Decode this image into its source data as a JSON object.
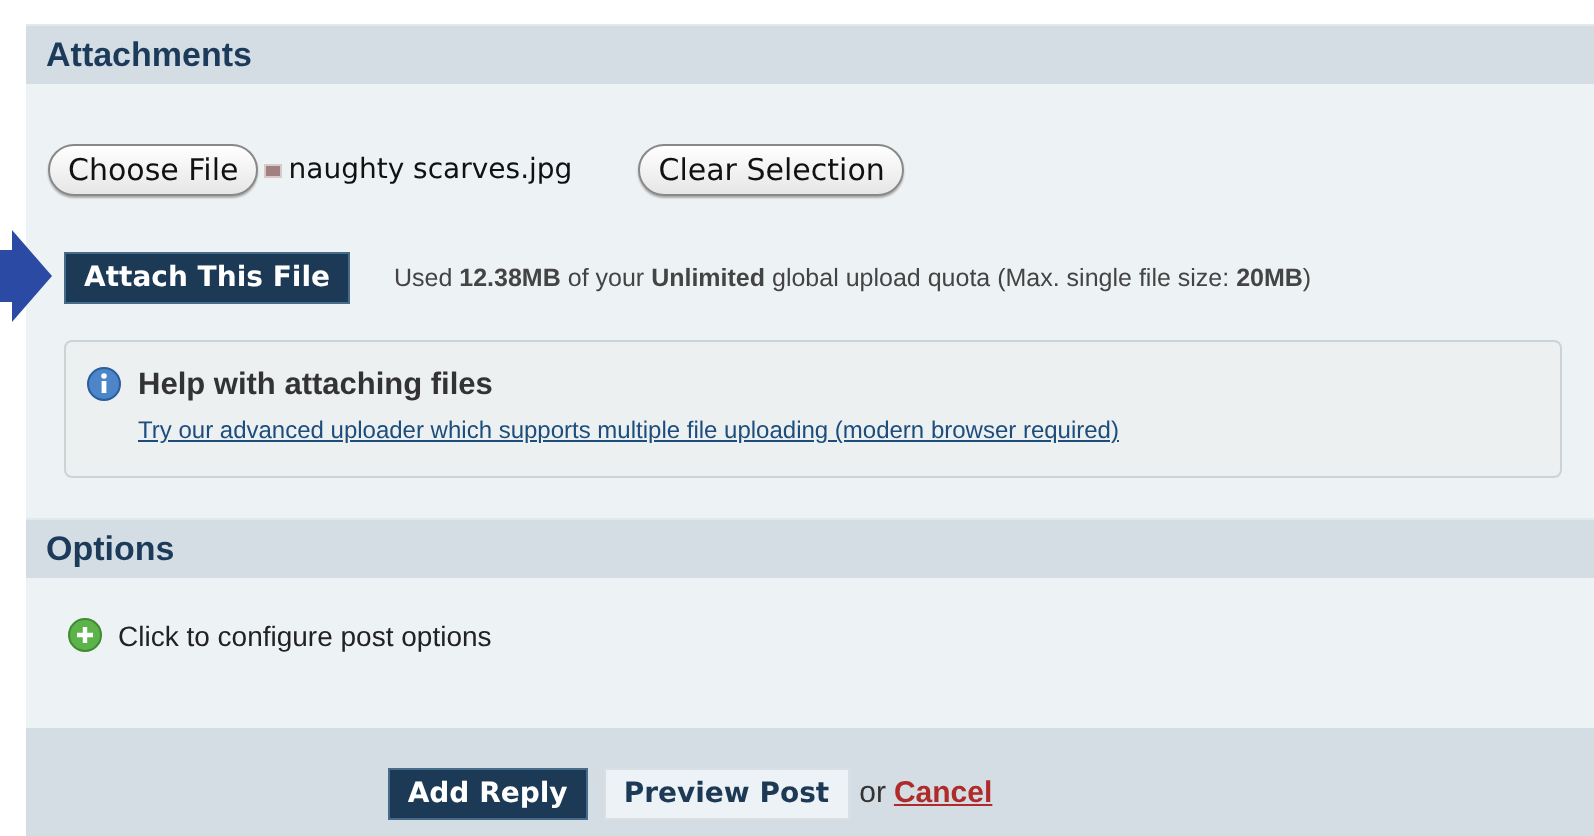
{
  "attachments": {
    "title": "Attachments",
    "choose_button": "Choose File",
    "file_name": "naughty scarves.jpg",
    "clear_button": "Clear Selection",
    "attach_button": "Attach This File",
    "quota": "Used **12.38MB** of your **Unlimited** global upload quota (Max. single file size: **20MB**)",
    "help": {
      "title": "Help with attaching files",
      "link": "Try our advanced uploader which supports multiple file uploading (modern browser required)"
    }
  },
  "options": {
    "title": "Options",
    "toggle": "Click to configure post options"
  },
  "footer": {
    "submit": "Add Reply",
    "preview": "Preview Post",
    "separator": "or",
    "cancel": "Cancel"
  }
}
